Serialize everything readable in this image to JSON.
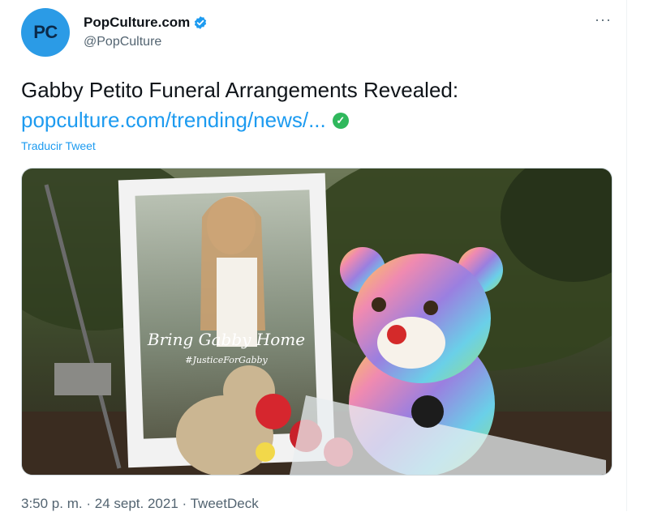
{
  "tweet": {
    "avatar_initials": "PC",
    "display_name": "PopCulture.com",
    "handle": "@PopCulture",
    "more_label": "···",
    "text": "Gabby Petito Funeral Arrangements Revealed:",
    "link_text": "popculture.com/trending/news/...",
    "translate_label": "Traducir Tweet",
    "time": "3:50 p. m.",
    "separator": "·",
    "date": "24 sept. 2021",
    "source": "TweetDeck"
  },
  "media": {
    "poster_caption": "Bring Gabby Home",
    "poster_hashtag": "#JusticeForGabby"
  },
  "colors": {
    "link": "#1d9bf0",
    "verified": "#1d9bf0",
    "secondary_text": "#536471",
    "avatar_bg": "#2b9be6"
  }
}
